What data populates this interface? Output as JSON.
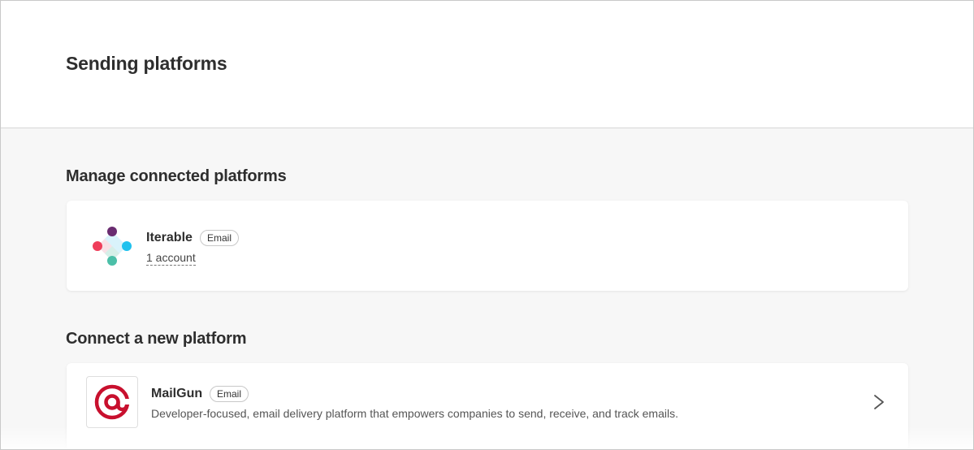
{
  "header": {
    "title": "Sending platforms"
  },
  "connected": {
    "section_title": "Manage connected platforms",
    "platforms": [
      {
        "name": "Iterable",
        "badge": "Email",
        "accounts": "1 account",
        "logo": "iterable-logo"
      }
    ]
  },
  "new_platforms": {
    "section_title": "Connect a new platform",
    "platforms": [
      {
        "name": "MailGun",
        "badge": "Email",
        "description": "Developer-focused, email delivery platform that empowers companies to send, receive, and track emails.",
        "logo": "mailgun-logo",
        "action_icon": "chevron-right-icon"
      }
    ]
  },
  "colors": {
    "background": "#f7f7f7",
    "card": "#ffffff",
    "mailgun_red": "#c8102e",
    "iterable_purple": "#6a2c70",
    "iterable_blue": "#1ec1ee",
    "iterable_red": "#ef3d5a",
    "iterable_teal": "#4bbfa8"
  }
}
